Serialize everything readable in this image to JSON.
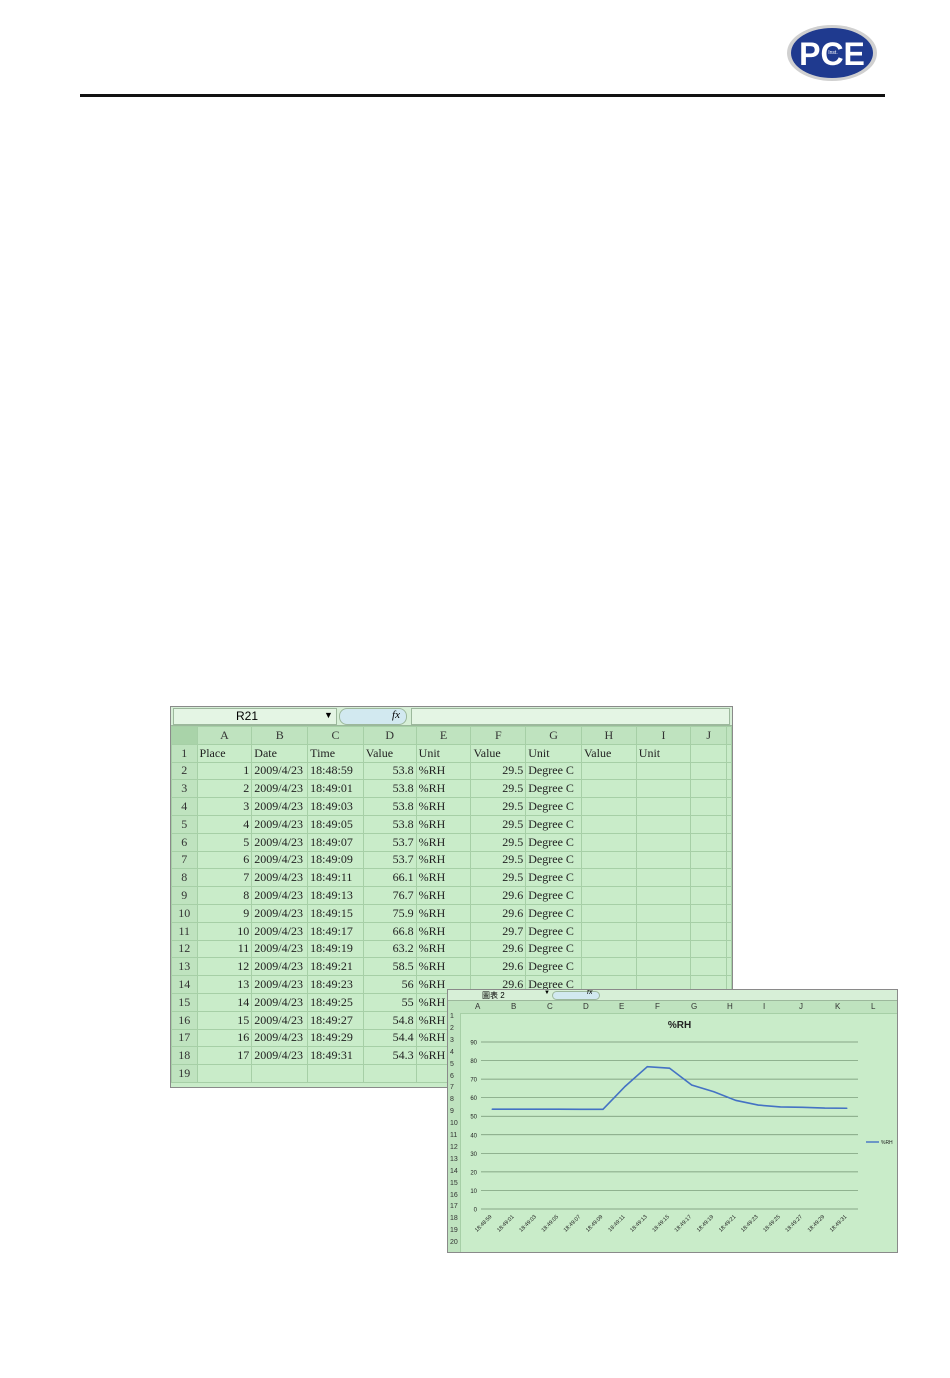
{
  "brand": {
    "logo_text": "PCE",
    "logo_subtext": "Inst.",
    "logo_color": "#1f3a8f"
  },
  "sheet1": {
    "name_box": "R21",
    "fx_symbol": "fx",
    "columns": [
      "A",
      "B",
      "C",
      "D",
      "E",
      "F",
      "G",
      "H",
      "I",
      "J"
    ],
    "header_row": [
      "Place",
      "Date",
      "Time",
      "Value",
      "Unit",
      "Value",
      "Unit",
      "Value",
      "Unit",
      ""
    ],
    "rows": [
      [
        "1",
        "2009/4/23",
        "18:48:59",
        "53.8",
        "%RH",
        "29.5",
        "Degree C"
      ],
      [
        "2",
        "2009/4/23",
        "18:49:01",
        "53.8",
        "%RH",
        "29.5",
        "Degree C"
      ],
      [
        "3",
        "2009/4/23",
        "18:49:03",
        "53.8",
        "%RH",
        "29.5",
        "Degree C"
      ],
      [
        "4",
        "2009/4/23",
        "18:49:05",
        "53.8",
        "%RH",
        "29.5",
        "Degree C"
      ],
      [
        "5",
        "2009/4/23",
        "18:49:07",
        "53.7",
        "%RH",
        "29.5",
        "Degree C"
      ],
      [
        "6",
        "2009/4/23",
        "18:49:09",
        "53.7",
        "%RH",
        "29.5",
        "Degree C"
      ],
      [
        "7",
        "2009/4/23",
        "18:49:11",
        "66.1",
        "%RH",
        "29.5",
        "Degree C"
      ],
      [
        "8",
        "2009/4/23",
        "18:49:13",
        "76.7",
        "%RH",
        "29.6",
        "Degree C"
      ],
      [
        "9",
        "2009/4/23",
        "18:49:15",
        "75.9",
        "%RH",
        "29.6",
        "Degree C"
      ],
      [
        "10",
        "2009/4/23",
        "18:49:17",
        "66.8",
        "%RH",
        "29.7",
        "Degree C"
      ],
      [
        "11",
        "2009/4/23",
        "18:49:19",
        "63.2",
        "%RH",
        "29.6",
        "Degree C"
      ],
      [
        "12",
        "2009/4/23",
        "18:49:21",
        "58.5",
        "%RH",
        "29.6",
        "Degree C"
      ],
      [
        "13",
        "2009/4/23",
        "18:49:23",
        "56",
        "%RH",
        "29.6",
        "Degree C"
      ],
      [
        "14",
        "2009/4/23",
        "18:49:25",
        "55",
        "%RH",
        "",
        ""
      ],
      [
        "15",
        "2009/4/23",
        "18:49:27",
        "54.8",
        "%RH",
        "",
        ""
      ],
      [
        "16",
        "2009/4/23",
        "18:49:29",
        "54.4",
        "%RH",
        "",
        ""
      ],
      [
        "17",
        "2009/4/23",
        "18:49:31",
        "54.3",
        "%RH",
        "",
        ""
      ],
      [
        "",
        "",
        "",
        "",
        "",
        "",
        ""
      ]
    ]
  },
  "sheet2": {
    "name_box": "圖表 2",
    "fx_symbol": "fx",
    "columns": [
      "A",
      "B",
      "C",
      "D",
      "E",
      "F",
      "G",
      "H",
      "I",
      "J",
      "K",
      "L"
    ],
    "row_count": 20
  },
  "chart_data": {
    "type": "line",
    "title": "%RH",
    "categories": [
      "18:48:59",
      "18:49:01",
      "18:49:03",
      "18:49:05",
      "18:49:07",
      "18:49:09",
      "18:49:11",
      "18:49:13",
      "18:49:15",
      "18:49:17",
      "18:49:19",
      "18:49:21",
      "18:49:23",
      "18:49:25",
      "18:49:27",
      "18:49:29",
      "18:49:31"
    ],
    "series": [
      {
        "name": "%RH",
        "values": [
          53.8,
          53.8,
          53.8,
          53.8,
          53.7,
          53.7,
          66.1,
          76.7,
          75.9,
          66.8,
          63.2,
          58.5,
          56,
          55,
          54.8,
          54.4,
          54.3
        ],
        "color": "#4472c4"
      }
    ],
    "ylim": [
      0,
      90
    ],
    "yticks": [
      0,
      10,
      20,
      30,
      40,
      50,
      60,
      70,
      80,
      90
    ],
    "grid": true,
    "legend": "right"
  }
}
